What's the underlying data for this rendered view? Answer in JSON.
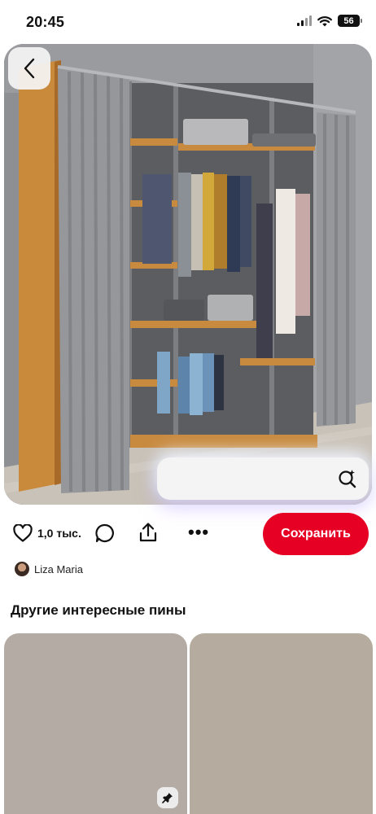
{
  "status_bar": {
    "time": "20:45",
    "battery": "56",
    "icons": [
      "cellular-signal-icon",
      "wifi-icon",
      "battery-icon"
    ]
  },
  "pin": {
    "image_description_icon": "wardrobe-photo",
    "back_icon": "chevron-left-icon",
    "visual_search_icon": "lens-search-icon"
  },
  "actions": {
    "like_icon": "heart-icon",
    "like_count": "1,0 тыс.",
    "comment_icon": "comment-icon",
    "share_icon": "share-icon",
    "more_label": "•••",
    "save_label": "Сохранить"
  },
  "author": {
    "name": "Liza Maria"
  },
  "section": {
    "title": "Другие интересные пины"
  },
  "colors": {
    "save_button": "#e60023",
    "card_1": "#b3aba4",
    "card_2": "#b5ac9f"
  }
}
